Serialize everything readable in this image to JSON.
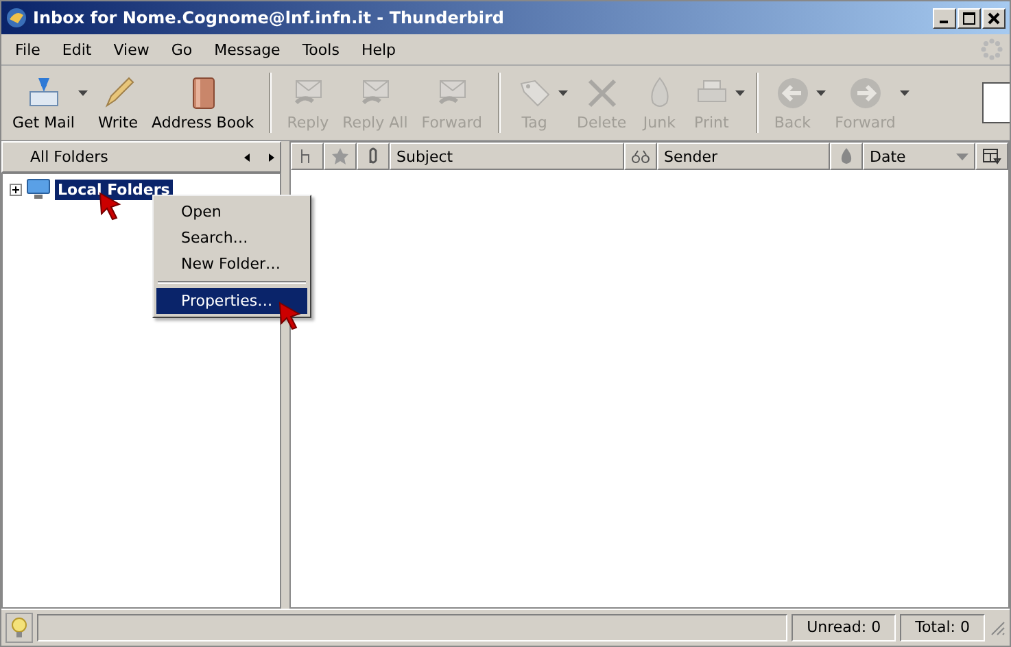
{
  "window": {
    "title": "Inbox for Nome.Cognome@lnf.infn.it - Thunderbird"
  },
  "menu_bar": [
    "File",
    "Edit",
    "View",
    "Go",
    "Message",
    "Tools",
    "Help"
  ],
  "toolbar": {
    "groups": [
      [
        {
          "label": "Get Mail",
          "disabled": false,
          "dropdown": true
        },
        {
          "label": "Write",
          "disabled": false,
          "dropdown": false
        },
        {
          "label": "Address Book",
          "disabled": false,
          "dropdown": false
        }
      ],
      [
        {
          "label": "Reply",
          "disabled": true,
          "dropdown": false
        },
        {
          "label": "Reply All",
          "disabled": true,
          "dropdown": false
        },
        {
          "label": "Forward",
          "disabled": true,
          "dropdown": false
        }
      ],
      [
        {
          "label": "Tag",
          "disabled": true,
          "dropdown": true
        },
        {
          "label": "Delete",
          "disabled": true,
          "dropdown": false
        },
        {
          "label": "Junk",
          "disabled": true,
          "dropdown": false
        },
        {
          "label": "Print",
          "disabled": true,
          "dropdown": true
        }
      ],
      [
        {
          "label": "Back",
          "disabled": true,
          "dropdown": true
        },
        {
          "label": "Forward",
          "disabled": true,
          "dropdown": true
        }
      ]
    ]
  },
  "folder_pane": {
    "header": "All Folders",
    "tree": [
      {
        "label": "Local Folders",
        "selected": true,
        "expanded": false
      }
    ]
  },
  "context_menu": {
    "items": [
      {
        "kind": "item",
        "label": "Open",
        "selected": false
      },
      {
        "kind": "item",
        "label": "Search…",
        "selected": false
      },
      {
        "kind": "item",
        "label": "New Folder…",
        "selected": false
      },
      {
        "kind": "separator"
      },
      {
        "kind": "item",
        "label": "Properties…",
        "selected": true
      }
    ]
  },
  "message_list": {
    "columns": [
      {
        "kind": "icon"
      },
      {
        "kind": "icon"
      },
      {
        "kind": "icon"
      },
      {
        "kind": "text",
        "label": "Subject",
        "sorted": false
      },
      {
        "kind": "icon"
      },
      {
        "kind": "text",
        "label": "Sender",
        "sorted": false
      },
      {
        "kind": "icon"
      },
      {
        "kind": "text",
        "label": "Date",
        "sorted": true
      },
      {
        "kind": "icon"
      }
    ]
  },
  "status_bar": {
    "unread": "Unread: 0",
    "total": "Total: 0"
  }
}
